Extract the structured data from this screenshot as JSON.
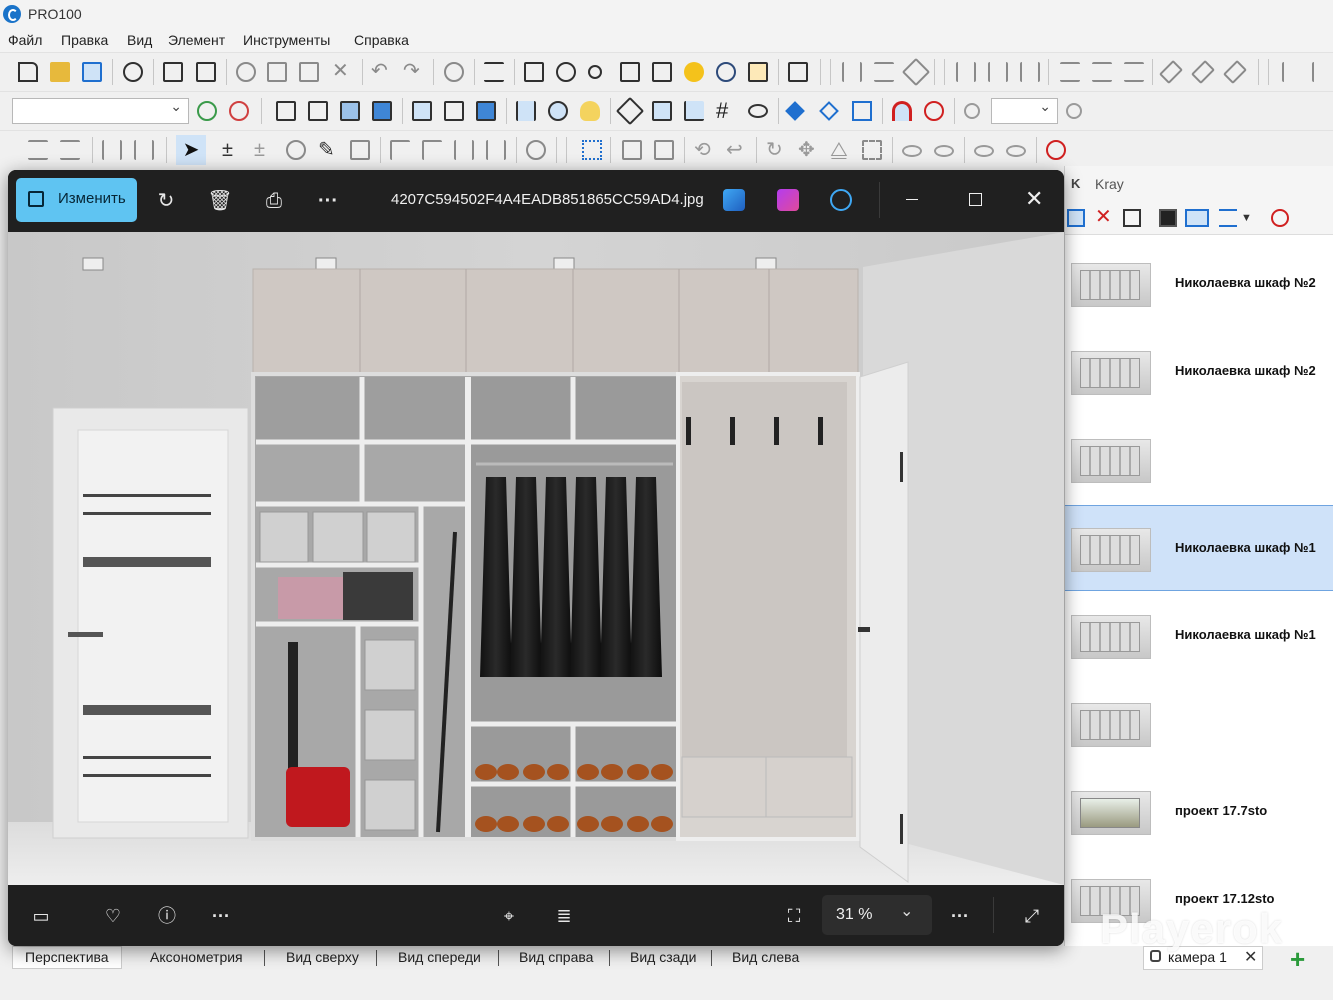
{
  "app": {
    "title": "PRO100"
  },
  "menu": [
    "Файл",
    "Правка",
    "Вид",
    "Элемент",
    "Инструменты",
    "Справка"
  ],
  "viewer": {
    "edit_label": "Изменить",
    "file_name": "4207C594502F4A4EADB851865CC59AD4.jpg",
    "zoom": "31 %"
  },
  "panel": {
    "k_label": "K",
    "title": "Kray",
    "projects": [
      {
        "name": "Николаевка шкаф №2",
        "selected": false
      },
      {
        "name": "Николаевка шкаф №2",
        "selected": false
      },
      {
        "name": "",
        "selected": false
      },
      {
        "name": "Николаевка шкаф №1",
        "selected": true
      },
      {
        "name": "Николаевка шкаф №1",
        "selected": false
      },
      {
        "name": "",
        "selected": false
      },
      {
        "name": "проект 17.7sto",
        "selected": false
      },
      {
        "name": "проект 17.12sto",
        "selected": false
      }
    ]
  },
  "view_tabs": [
    "Перспектива",
    "Аксонометрия",
    "Вид сверху",
    "Вид спереди",
    "Вид справа",
    "Вид сзади",
    "Вид слева"
  ],
  "camera": {
    "label": "камера 1"
  },
  "watermark": "Playerok",
  "colors": {
    "accent": "#5fc4f2",
    "viewer_bg": "#202020",
    "selection": "#cfe2f9"
  }
}
